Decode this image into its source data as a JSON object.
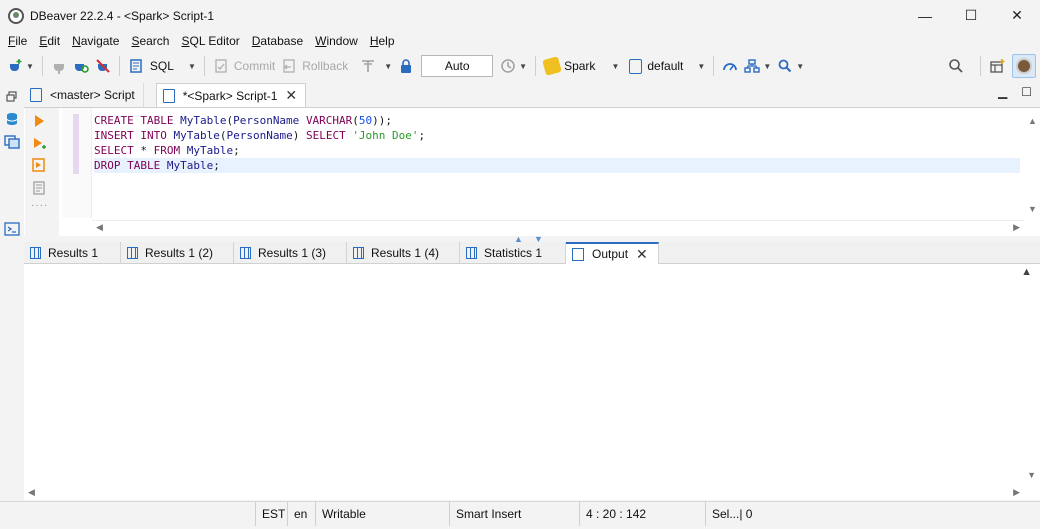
{
  "window": {
    "title": "DBeaver 22.2.4 - <Spark> Script-1",
    "minimize": "—",
    "maximize": "☐",
    "close": "✕"
  },
  "menu": [
    {
      "label": "File",
      "u": "F",
      "rest": "ile"
    },
    {
      "label": "Edit",
      "u": "E",
      "rest": "dit"
    },
    {
      "label": "Navigate",
      "u": "N",
      "rest": "avigate"
    },
    {
      "label": "Search",
      "u": "S",
      "rest": "earch"
    },
    {
      "label": "SQL Editor",
      "u": "S",
      "rest": "QL Editor"
    },
    {
      "label": "Database",
      "u": "D",
      "rest": "atabase"
    },
    {
      "label": "Window",
      "u": "W",
      "rest": "indow"
    },
    {
      "label": "Help",
      "u": "H",
      "rest": "elp"
    }
  ],
  "toolbar": {
    "sql_label": "SQL",
    "commit_label": "Commit",
    "rollback_label": "Rollback",
    "transaction_mode": "Auto",
    "datasource": "Spark",
    "schema": "default"
  },
  "editor_tabs": [
    {
      "label": "<master> Script",
      "active": false
    },
    {
      "label": "*<Spark> Script-1",
      "active": true
    }
  ],
  "code_lines": [
    [
      [
        "kw",
        "CREATE TABLE "
      ],
      [
        "id",
        "MyTable"
      ],
      [
        "pun",
        "("
      ],
      [
        "id",
        "PersonName "
      ],
      [
        "fn",
        "VARCHAR"
      ],
      [
        "pun",
        "("
      ],
      [
        "num",
        "50"
      ],
      [
        "pun",
        "));"
      ]
    ],
    [
      [
        "kw",
        "INSERT INTO "
      ],
      [
        "id",
        "MyTable"
      ],
      [
        "pun",
        "("
      ],
      [
        "id",
        "PersonName"
      ],
      [
        "pun",
        ") "
      ],
      [
        "kw",
        "SELECT "
      ],
      [
        "str",
        "'John Doe'"
      ],
      [
        "pun",
        ";"
      ]
    ],
    [
      [
        "kw",
        "SELECT "
      ],
      [
        "pun",
        "* "
      ],
      [
        "kw",
        "FROM "
      ],
      [
        "id",
        "MyTable"
      ],
      [
        "pun",
        ";"
      ]
    ],
    [
      [
        "kw",
        "DROP TABLE "
      ],
      [
        "id",
        "MyTable"
      ],
      [
        "pun",
        ";"
      ]
    ]
  ],
  "result_tabs": [
    {
      "label": "Results 1",
      "active": false
    },
    {
      "label": "Results 1 (2)",
      "active": false
    },
    {
      "label": "Results 1 (3)",
      "active": false
    },
    {
      "label": "Results 1 (4)",
      "active": false
    },
    {
      "label": "Statistics 1",
      "active": false
    },
    {
      "label": "Output",
      "active": true
    }
  ],
  "status": {
    "timezone": "EST",
    "locale": "en",
    "mode": "Writable",
    "insert_mode": "Smart Insert",
    "position": "4 : 20 : 142",
    "selection": "Sel...| 0"
  }
}
